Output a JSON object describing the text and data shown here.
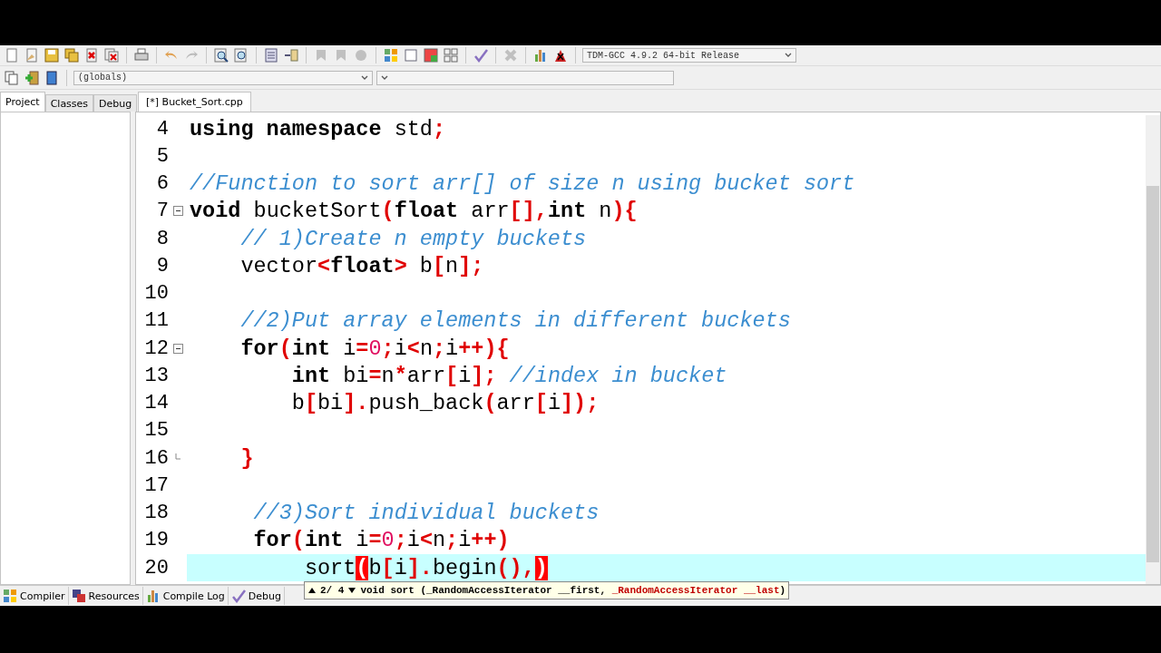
{
  "toolbar": {
    "compiler_select": {
      "value": "TDM-GCC 4.9.2 64-bit Release"
    }
  },
  "toolbar2": {
    "scope_select": {
      "value": "(globals)"
    }
  },
  "left_panel": {
    "tabs": [
      {
        "label": "Project",
        "selected": true
      },
      {
        "label": "Classes",
        "selected": false
      },
      {
        "label": "Debug",
        "selected": false
      }
    ]
  },
  "editor": {
    "tabs": [
      {
        "label": "[*] Bucket_Sort.cpp",
        "selected": true
      }
    ],
    "lines": [
      {
        "number": "4",
        "current": false,
        "tokens": [
          {
            "kind": "kw",
            "text": "using namespace"
          },
          {
            "kind": "id",
            "text": " std"
          },
          {
            "kind": "sym",
            "text": ";"
          }
        ]
      },
      {
        "number": "5",
        "current": false
      },
      {
        "number": "6",
        "current": false,
        "tokens": [
          {
            "kind": "comment",
            "text": "//Function to sort arr[] of size n using bucket sort"
          }
        ]
      },
      {
        "number": "7",
        "current": false,
        "fold_start": true,
        "tokens": [
          {
            "kind": "kw",
            "text": "void"
          },
          {
            "kind": "id",
            "text": " bucketSort"
          },
          {
            "kind": "sym",
            "text": "("
          },
          {
            "kind": "kw",
            "text": "float"
          },
          {
            "kind": "id",
            "text": " arr"
          },
          {
            "kind": "sym",
            "text": "[],"
          },
          {
            "kind": "kw",
            "text": "int"
          },
          {
            "kind": "id",
            "text": " n"
          },
          {
            "kind": "sym",
            "text": "){"
          }
        ]
      },
      {
        "number": "8",
        "current": false,
        "tokens": [
          {
            "kind": "comment",
            "text": "    // 1)Create n empty buckets"
          }
        ]
      },
      {
        "number": "9",
        "current": false,
        "tokens": [
          {
            "kind": "id",
            "text": "    vector"
          },
          {
            "kind": "sym",
            "text": "<"
          },
          {
            "kind": "kw",
            "text": "float"
          },
          {
            "kind": "sym",
            "text": ">"
          },
          {
            "kind": "id",
            "text": " b"
          },
          {
            "kind": "sym",
            "text": "["
          },
          {
            "kind": "id",
            "text": "n"
          },
          {
            "kind": "sym",
            "text": "];"
          }
        ]
      },
      {
        "number": "10",
        "current": false
      },
      {
        "number": "11",
        "current": false,
        "tokens": [
          {
            "kind": "comment",
            "text": "    //2)Put array elements in different buckets"
          }
        ]
      },
      {
        "number": "12",
        "current": false,
        "fold_start": true,
        "tokens": [
          {
            "kind": "kw",
            "text": "    for"
          },
          {
            "kind": "sym",
            "text": "("
          },
          {
            "kind": "kw",
            "text": "int"
          },
          {
            "kind": "id",
            "text": " i"
          },
          {
            "kind": "sym",
            "text": "="
          },
          {
            "kind": "num",
            "text": "0"
          },
          {
            "kind": "sym",
            "text": ";"
          },
          {
            "kind": "id",
            "text": "i"
          },
          {
            "kind": "sym",
            "text": "<"
          },
          {
            "kind": "id",
            "text": "n"
          },
          {
            "kind": "sym",
            "text": ";"
          },
          {
            "kind": "id",
            "text": "i"
          },
          {
            "kind": "sym",
            "text": "++){"
          }
        ]
      },
      {
        "number": "13",
        "current": false,
        "tokens": [
          {
            "kind": "kw",
            "text": "        int"
          },
          {
            "kind": "id",
            "text": " bi"
          },
          {
            "kind": "sym",
            "text": "="
          },
          {
            "kind": "id",
            "text": "n"
          },
          {
            "kind": "sym",
            "text": "*"
          },
          {
            "kind": "id",
            "text": "arr"
          },
          {
            "kind": "sym",
            "text": "["
          },
          {
            "kind": "id",
            "text": "i"
          },
          {
            "kind": "sym",
            "text": "];"
          },
          {
            "kind": "comment",
            "text": " //index in bucket"
          }
        ]
      },
      {
        "number": "14",
        "current": false,
        "tokens": [
          {
            "kind": "id",
            "text": "        b"
          },
          {
            "kind": "sym",
            "text": "["
          },
          {
            "kind": "id",
            "text": "bi"
          },
          {
            "kind": "sym",
            "text": "]."
          },
          {
            "kind": "id",
            "text": "push_back"
          },
          {
            "kind": "sym",
            "text": "("
          },
          {
            "kind": "id",
            "text": "arr"
          },
          {
            "kind": "sym",
            "text": "["
          },
          {
            "kind": "id",
            "text": "i"
          },
          {
            "kind": "sym",
            "text": "]);"
          }
        ]
      },
      {
        "number": "15",
        "current": false
      },
      {
        "number": "16",
        "current": false,
        "fold_end": true,
        "tokens": [
          {
            "kind": "sym",
            "text": "    }"
          }
        ]
      },
      {
        "number": "17",
        "current": false
      },
      {
        "number": "18",
        "current": false,
        "tokens": [
          {
            "kind": "comment",
            "text": "     //3)Sort individual buckets"
          }
        ]
      },
      {
        "number": "19",
        "current": false,
        "tokens": [
          {
            "kind": "kw",
            "text": "     for"
          },
          {
            "kind": "sym",
            "text": "("
          },
          {
            "kind": "kw",
            "text": "int"
          },
          {
            "kind": "id",
            "text": " i"
          },
          {
            "kind": "sym",
            "text": "="
          },
          {
            "kind": "num",
            "text": "0"
          },
          {
            "kind": "sym",
            "text": ";"
          },
          {
            "kind": "id",
            "text": "i"
          },
          {
            "kind": "sym",
            "text": "<"
          },
          {
            "kind": "id",
            "text": "n"
          },
          {
            "kind": "sym",
            "text": ";"
          },
          {
            "kind": "id",
            "text": "i"
          },
          {
            "kind": "sym",
            "text": "++)"
          }
        ]
      },
      {
        "number": "20",
        "current": true,
        "tokens": [
          {
            "kind": "id",
            "text": "         sort"
          },
          {
            "kind": "match",
            "text": "("
          },
          {
            "kind": "id",
            "text": "b"
          },
          {
            "kind": "sym",
            "text": "["
          },
          {
            "kind": "id",
            "text": "i"
          },
          {
            "kind": "sym",
            "text": "]."
          },
          {
            "kind": "id",
            "text": "begin"
          },
          {
            "kind": "sym",
            "text": "(),"
          },
          {
            "kind": "match",
            "text": ")"
          }
        ]
      }
    ]
  },
  "tooltip": {
    "counter": "2/ 4",
    "segments": [
      {
        "text": "void sort (_RandomAccessIterator __first, ",
        "highlighted": false
      },
      {
        "text": "_RandomAccessIterator __last",
        "highlighted": true
      },
      {
        "text": ")",
        "highlighted": false
      }
    ]
  },
  "bottom_tabs": [
    {
      "label": "Compiler",
      "selected": false
    },
    {
      "label": "Resources",
      "selected": false
    },
    {
      "label": "Compile Log",
      "selected": false
    },
    {
      "label": "Debug",
      "selected": false
    }
  ]
}
